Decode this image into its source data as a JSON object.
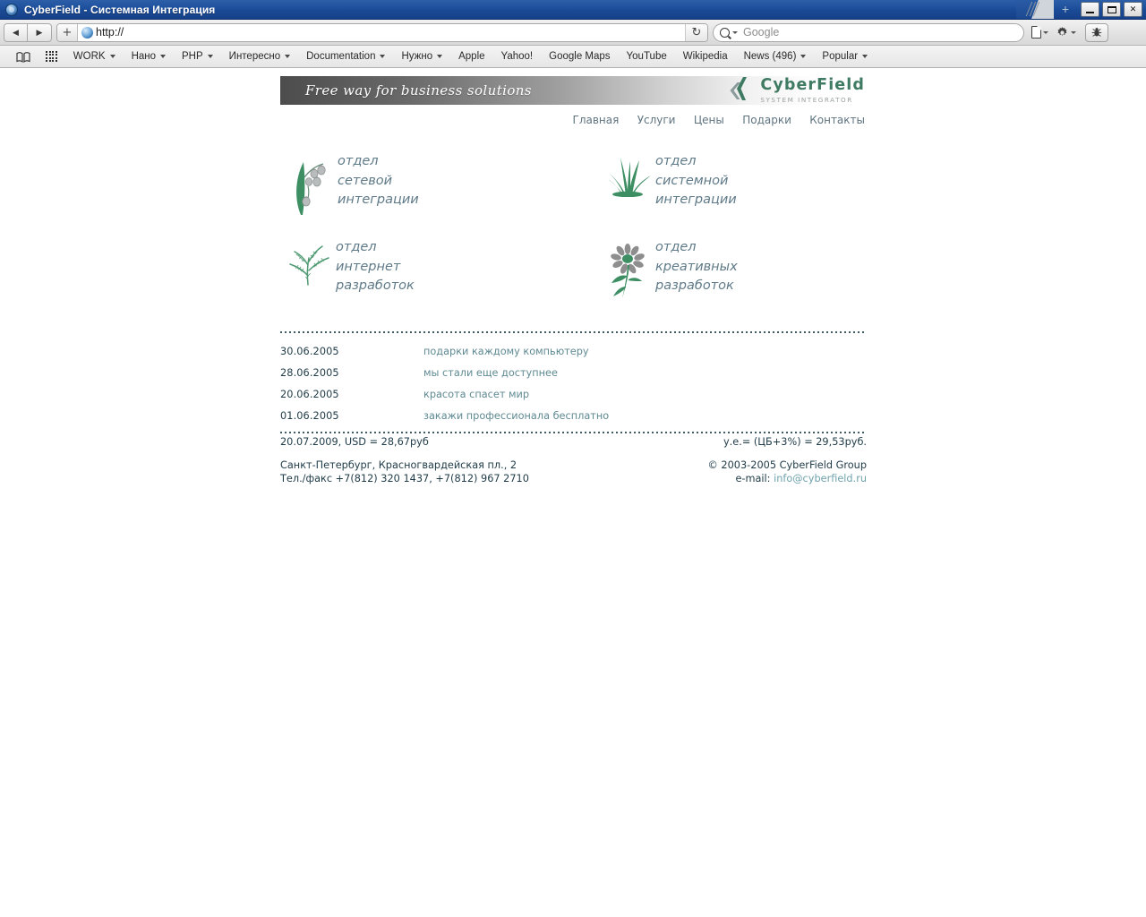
{
  "window": {
    "title": "CyberField - Системная Интеграция",
    "icon": "compass-icon",
    "new_tab_label": "+",
    "minimize_label": "",
    "maximize_label": "",
    "close_label": "✕"
  },
  "toolbar": {
    "back_label": "◀",
    "forward_label": "▶",
    "new_tab_label": "+",
    "url_value": "http://",
    "url_placeholder": "http://",
    "reload_label": "↻",
    "search_placeholder": "Google",
    "search_value": "",
    "page_menu_label": "",
    "gear_menu_label": "",
    "bug_label": ""
  },
  "bookmarks": [
    {
      "label": "",
      "icon": "book-icon",
      "caret": false
    },
    {
      "label": "",
      "icon": "grid-icon",
      "caret": false
    },
    {
      "label": "WORK",
      "icon": "",
      "caret": true
    },
    {
      "label": "Нано",
      "icon": "",
      "caret": true
    },
    {
      "label": "PHP",
      "icon": "",
      "caret": true
    },
    {
      "label": "Интересно",
      "icon": "",
      "caret": true
    },
    {
      "label": "Documentation",
      "icon": "",
      "caret": true
    },
    {
      "label": "Нужно",
      "icon": "",
      "caret": true
    },
    {
      "label": "Apple",
      "icon": "",
      "caret": false
    },
    {
      "label": "Yahoo!",
      "icon": "",
      "caret": false
    },
    {
      "label": "Google Maps",
      "icon": "",
      "caret": false
    },
    {
      "label": "YouTube",
      "icon": "",
      "caret": false
    },
    {
      "label": "Wikipedia",
      "icon": "",
      "caret": false
    },
    {
      "label": "News (496)",
      "icon": "",
      "caret": true
    },
    {
      "label": "Popular",
      "icon": "",
      "caret": true
    }
  ],
  "site": {
    "slogan": "Free way for business solutions",
    "logo_name": "CyberField",
    "logo_sub": "SYSTEM INTEGRATOR",
    "nav": [
      {
        "label": "Главная"
      },
      {
        "label": "Услуги"
      },
      {
        "label": "Цены"
      },
      {
        "label": "Подарки"
      },
      {
        "label": "Контакты"
      }
    ],
    "departments": [
      {
        "icon": "lily-of-the-valley-icon",
        "label": "отдел\nсетевой\nинтеграции"
      },
      {
        "icon": "grass-icon",
        "label": "отдел\nсистемной\nинтеграции"
      },
      {
        "icon": "dill-icon",
        "label": "отдел\nинтернет\nразработок"
      },
      {
        "icon": "daisy-icon",
        "label": "отдел\nкреативных\nразработок"
      }
    ],
    "news": [
      {
        "date": "30.06.2005",
        "title": "подарки каждому компьютеру"
      },
      {
        "date": "28.06.2005",
        "title": "мы стали еще доступнее"
      },
      {
        "date": "20.06.2005",
        "title": "красота спасет мир"
      },
      {
        "date": "01.06.2005",
        "title": "закажи профессионала бесплатно"
      }
    ],
    "rates": {
      "left": "20.07.2009, USD = 28,67руб",
      "right": "у.е.= (ЦБ+3%) = 29,53руб."
    },
    "footer": {
      "address": "Санкт-Петербург, Красногвардейская пл., 2",
      "phone": "Тел./факс +7(812) 320 1437, +7(812) 967 2710",
      "copyright": "©  2003-2005 CyberField Group",
      "email_label": "e-mail: ",
      "email": "info@cyberfield.ru"
    }
  },
  "colors": {
    "brand_green": "#3f7a62",
    "leaf_green": "#3d8f63",
    "petal_gray": "#8e8e8e",
    "slate": "#5f7a88",
    "link": "#5f8a93",
    "title_blue": "#1d4f9c"
  }
}
